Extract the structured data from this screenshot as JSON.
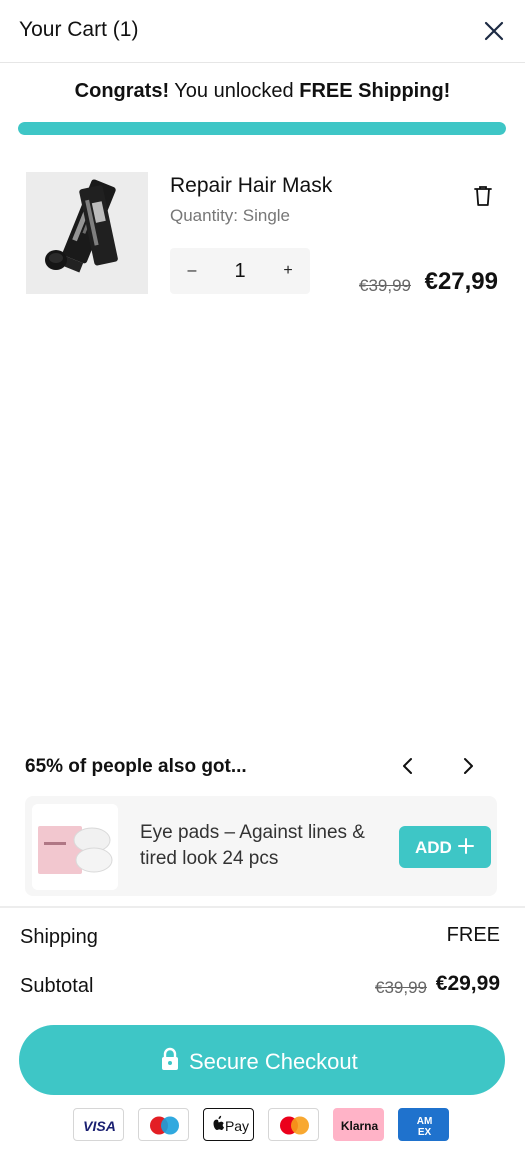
{
  "colors": {
    "accent": "#3ec6c6",
    "text": "#111111",
    "muted": "#777777"
  },
  "header": {
    "title": "Your Cart (1)",
    "close_icon": "close-icon"
  },
  "promo": {
    "bold_start": "Congrats!",
    "middle": " You unlocked ",
    "bold_end": "FREE Shipping!",
    "progress_percent": 100
  },
  "cart_items": [
    {
      "name": "Repair Hair Mask",
      "variant": "Quantity: Single",
      "quantity": "1",
      "minus_label": "–",
      "plus_label": "+",
      "old_price": "€39,99",
      "price": "€27,99",
      "image_icon": "product-image",
      "delete_icon": "trash-icon"
    }
  ],
  "upsell": {
    "heading": "65% of people also got...",
    "prev_icon": "chevron-left-icon",
    "next_icon": "chevron-right-icon",
    "item": {
      "name": "Eye pads – Against lines & tired look 24 pcs",
      "add_label": "ADD",
      "add_icon": "plus-icon"
    }
  },
  "summary": {
    "shipping_label": "Shipping",
    "shipping_value": "FREE",
    "subtotal_label": "Subtotal",
    "subtotal_old": "€39,99",
    "subtotal_new": "€29,99"
  },
  "checkout": {
    "label": "Secure Checkout",
    "icon": "lock-icon"
  },
  "payment_methods": [
    {
      "name": "VISA",
      "icon": "visa-icon"
    },
    {
      "name": "Maestro",
      "icon": "maestro-icon"
    },
    {
      "name": "Pay",
      "icon": "apple-pay-icon"
    },
    {
      "name": "Mastercard",
      "icon": "mastercard-icon"
    },
    {
      "name": "Klarna",
      "icon": "klarna-icon"
    },
    {
      "name": "AMEX",
      "icon": "amex-icon"
    }
  ]
}
